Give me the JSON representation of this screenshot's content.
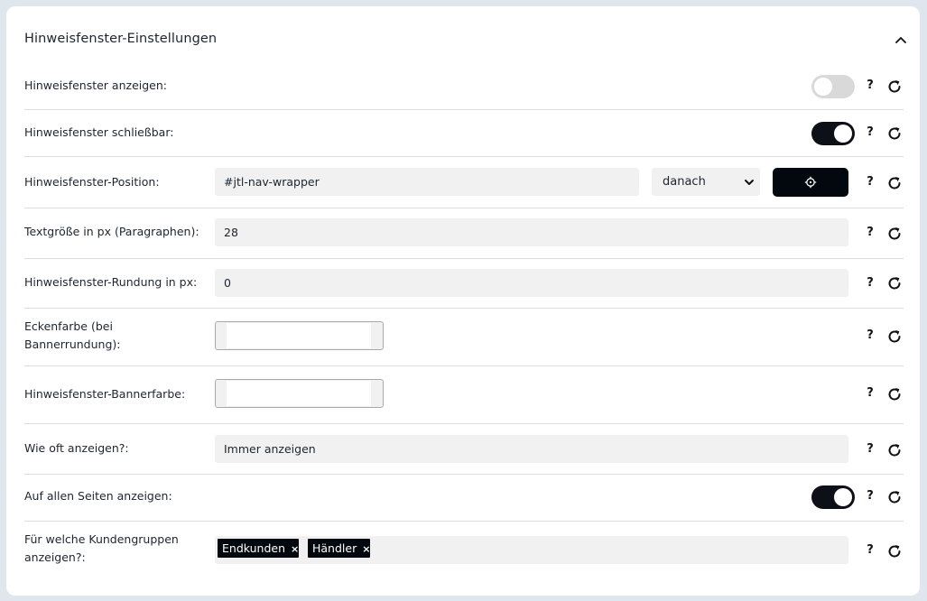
{
  "panel": {
    "title": "Hinweisfenster-Einstellungen",
    "collapse_icon": "chevron-up-icon"
  },
  "help_label": "?",
  "reset_icon": "refresh-icon",
  "settings": {
    "show": {
      "label": "Hinweisfenster anzeigen:",
      "enabled": false
    },
    "closable": {
      "label": "Hinweisfenster schließbar:",
      "enabled": true
    },
    "position": {
      "label": "Hinweisfenster-Position:",
      "selector_value": "#jtl-nav-wrapper",
      "placement_value": "danach",
      "picker_icon": "crosshair-icon"
    },
    "font_size": {
      "label": "Textgröße in px (Paragraphen):",
      "value": "28"
    },
    "rounding": {
      "label": "Hinweisfenster-Rundung in px:",
      "value": "0"
    },
    "corner_color": {
      "label": "Eckenfarbe (bei Bannerrundung):",
      "color": "#ffffff"
    },
    "banner_color": {
      "label": "Hinweisfenster-Bannerfarbe:",
      "color": "#ffffff"
    },
    "frequency": {
      "label": "Wie oft anzeigen?:",
      "value": "Immer anzeigen"
    },
    "all_pages": {
      "label": "Auf allen Seiten anzeigen:",
      "enabled": true
    },
    "customer_groups": {
      "label": "Für welche Kundengruppen anzeigen?:",
      "tags": [
        "Endkunden",
        "Händler"
      ],
      "remove_symbol": "×"
    }
  },
  "colors": {
    "accent_dark": "#0d1117",
    "toggle_off": "#d9d9d9",
    "field_bg": "#f1f1f1"
  }
}
